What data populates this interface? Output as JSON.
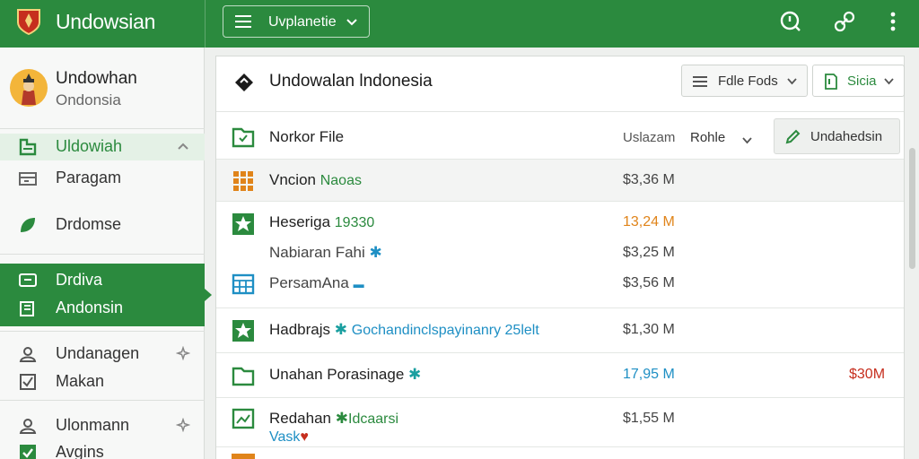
{
  "topbar": {
    "app_name": "Undowsian",
    "dropdown_label": "Uvplanetie"
  },
  "sidebar": {
    "profile_name": "Undowhan",
    "profile_subtitle": "Ondonsia",
    "items": [
      {
        "label": "Uldowiah"
      },
      {
        "label": "Paragam"
      },
      {
        "label": "Drdomse"
      },
      {
        "label": "Drdiva"
      },
      {
        "label": "Andonsin"
      },
      {
        "label": "Undanagen"
      },
      {
        "label": "Makan"
      },
      {
        "label": "Ulonmann"
      },
      {
        "label": "Avgins"
      }
    ]
  },
  "main": {
    "title": "Undowalan lndonesia",
    "file_fods_label": "Fdle Fods",
    "sicia_label": "Sicia",
    "header_row": {
      "name": "Norkor File",
      "col_a": "Uslazam",
      "col_b": "Rohle",
      "action_label": "Undahedsin"
    },
    "rows": [
      {
        "name": "Vncion",
        "tag": "Naoas",
        "size": "$3,36 M"
      },
      {
        "name": "Heseriga",
        "tag": "19330",
        "size": "13,24 M",
        "size_color": "#e0841a"
      },
      {
        "name": "Nabiaran Fahi",
        "size": "$3,25 M"
      },
      {
        "name": "PersamAna",
        "size": "$3,56 M"
      },
      {
        "name": "Hadbrajs",
        "tag": "Gochandinclspayinanry 25lelt",
        "size": "$1,30 M"
      },
      {
        "name": "Unahan Porasinage",
        "size": "17,95 M",
        "size_color": "#1e8fc4",
        "extra": "$30M",
        "extra_color": "#c62e1e"
      },
      {
        "name": "Redahan",
        "tag": "Idcaarsi",
        "sub": "Vask",
        "size": "$1,55 M"
      }
    ]
  },
  "colors": {
    "brand_green": "#2b8a3e",
    "orange": "#e0841a",
    "blue": "#1e8fc4",
    "red": "#c62e1e"
  }
}
